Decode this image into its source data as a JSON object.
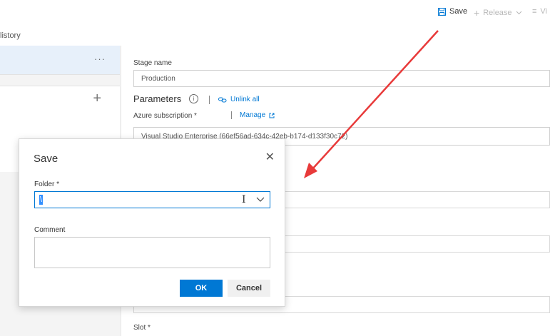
{
  "toolbar": {
    "save_label": "Save",
    "release_label": "Release",
    "view_label": "Vi"
  },
  "history_tab": "listory",
  "form": {
    "stage_name_label": "Stage name",
    "stage_name_value": "Production",
    "parameters_heading": "Parameters",
    "unlink_all_label": "Unlink all",
    "azure_subscription_label": "Azure subscription *",
    "manage_label": "Manage",
    "subscription_value": "Visual Studio Enterprise (66ef56ad-634c-42eb-b174-d133f3",
    "subscription_value_tail": "0c72)",
    "slot_label": "Slot *"
  },
  "dialog": {
    "title": "Save",
    "close_glyph": "✕",
    "folder_label": "Folder *",
    "folder_value": "\\",
    "comment_label": "Comment",
    "comment_value": "",
    "ok_label": "OK",
    "cancel_label": "Cancel"
  },
  "left_panel": {
    "more_glyph": "···",
    "add_glyph": "+"
  },
  "colors": {
    "accent": "#0078d4",
    "annotation_arrow": "#e83a3a"
  }
}
